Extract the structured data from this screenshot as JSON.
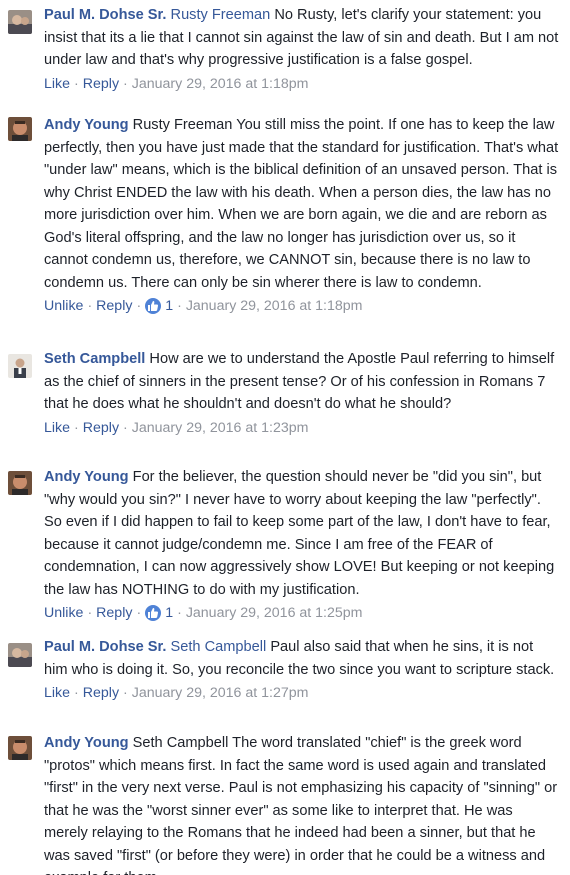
{
  "comments": [
    {
      "author": "Paul M. Dohse Sr.",
      "mention": "Rusty Freeman",
      "text": " No Rusty, let's clarify your statement: you insist that its a lie that I cannot sin against the law of sin and death. But I am not under law and that's why progressive justification is a false gospel.",
      "like_label": "Like",
      "reply_label": "Reply",
      "timestamp": "January 29, 2016 at 1:18pm",
      "avatar_icon": "paul-avatar"
    },
    {
      "author": "Andy Young",
      "mention": "",
      "text": " Rusty Freeman You still miss the point. If one has to keep the law perfectly, then you have just made that the standard for justification. That's what \"under law\" means, which is the biblical definition of an unsaved person. That is why Christ ENDED the law with his death. When a person dies, the law has no more jurisdiction over him. When we are born again, we die and are reborn as God's literal offspring, and the law no longer has jurisdiction over us, so it cannot condemn us, therefore, we CANNOT sin, because there is no law to condemn us. There can only be sin wherer there is law to condemn.",
      "like_label": "Unlike",
      "reply_label": "Reply",
      "like_count": "1",
      "timestamp": "January 29, 2016 at 1:18pm",
      "avatar_icon": "andy-avatar"
    },
    {
      "author": "Seth Campbell",
      "mention": "",
      "text": " How are we to understand the Apostle Paul referring to himself as the chief of sinners in the present tense? Or of his confession in Romans 7 that he does what he shouldn't and doesn't do what he should?",
      "like_label": "Like",
      "reply_label": "Reply",
      "timestamp": "January 29, 2016 at 1:23pm",
      "avatar_icon": "seth-avatar"
    },
    {
      "author": "Andy Young",
      "mention": "",
      "text": " For the believer, the question should never be \"did you sin\", but \"why would you sin?\" I never have to worry about keeping the law \"perfectly\". So even if I did happen to fail to keep some part of the law, I don't have to fear, because it cannot judge/condemn me. Since I am free of the FEAR of condemnation, I can now aggressively show LOVE! But keeping or not keeping the law has NOTHING to do with my justification.",
      "like_label": "Unlike",
      "reply_label": "Reply",
      "like_count": "1",
      "timestamp": "January 29, 2016 at 1:25pm",
      "avatar_icon": "andy-avatar"
    },
    {
      "author": "Paul M. Dohse Sr.",
      "mention": "Seth Campbell",
      "text": " Paul also said that when he sins, it is not him who is doing it. So, you reconcile the two since you want to scripture stack.",
      "like_label": "Like",
      "reply_label": "Reply",
      "timestamp": "January 29, 2016 at 1:27pm",
      "avatar_icon": "paul-avatar"
    },
    {
      "author": "Andy Young",
      "mention": "",
      "text": " Seth Campbell The word translated \"chief\" is the greek word \"protos\" which means first. In fact the same word is used again and translated \"first\" in the very next verse. Paul is not emphasizing his capacity of \"sinning\" or that he was the \"worst sinner ever\" as some like to interpret that. He was merely relaying to the Romans that he indeed had been a sinner, but that he was saved \"first\" (or before they were) in order that he could be a witness and example for them.",
      "avatar_icon": "andy-avatar"
    }
  ],
  "separator": "·",
  "colors": {
    "link": "#365899",
    "meta": "#90949c",
    "text": "#1d2129",
    "like_bubble": "#4f82d6"
  }
}
